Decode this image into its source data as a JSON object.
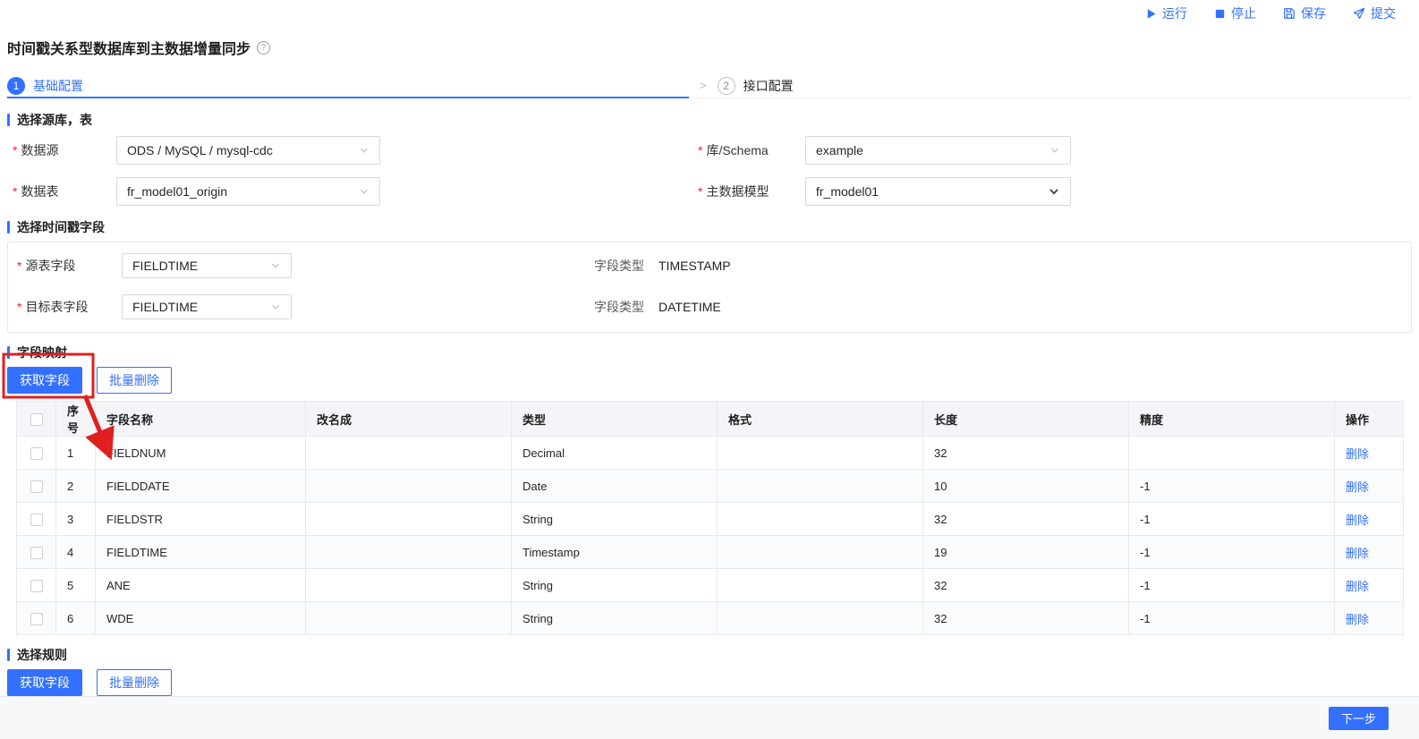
{
  "ui": {
    "required_mark": "*",
    "step_separator": ">",
    "help_mark": "?"
  },
  "colors": {
    "primary": "#3370ff",
    "annotation": "#e01f1f"
  },
  "toolbar": {
    "run_label": "运行",
    "stop_label": "停止",
    "save_label": "保存",
    "submit_label": "提交"
  },
  "page": {
    "title": "时间戳关系型数据库到主数据增量同步"
  },
  "steps": [
    {
      "num": "1",
      "label": "基础配置"
    },
    {
      "num": "2",
      "label": "接口配置"
    }
  ],
  "source_section": {
    "title": "选择源库，表",
    "datasource": {
      "label": "数据源",
      "value": "ODS / MySQL / mysql-cdc"
    },
    "schema": {
      "label": "库/Schema",
      "value": "example"
    },
    "table": {
      "label": "数据表",
      "value": "fr_model01_origin"
    },
    "model": {
      "label": "主数据模型",
      "value": "fr_model01"
    }
  },
  "timestamp_section": {
    "title": "选择时间戳字段",
    "source_field": {
      "label": "源表字段",
      "value": "FIELDTIME",
      "type_label": "字段类型",
      "type_value": "TIMESTAMP"
    },
    "target_field": {
      "label": "目标表字段",
      "value": "FIELDTIME",
      "type_label": "字段类型",
      "type_value": "DATETIME"
    }
  },
  "mapping_section": {
    "title": "字段映射",
    "get_fields_label": "获取字段",
    "batch_delete_label": "批量删除",
    "table": {
      "headers": [
        "序号",
        "字段名称",
        "改名成",
        "类型",
        "格式",
        "长度",
        "精度",
        "操作"
      ],
      "rows": [
        {
          "no": "1",
          "name": "FIELDNUM",
          "rename": "",
          "type": "Decimal",
          "format": "",
          "length": "32",
          "precision": "",
          "action": "删除"
        },
        {
          "no": "2",
          "name": "FIELDDATE",
          "rename": "",
          "type": "Date",
          "format": "",
          "length": "10",
          "precision": "-1",
          "action": "删除"
        },
        {
          "no": "3",
          "name": "FIELDSTR",
          "rename": "",
          "type": "String",
          "format": "",
          "length": "32",
          "precision": "-1",
          "action": "删除"
        },
        {
          "no": "4",
          "name": "FIELDTIME",
          "rename": "",
          "type": "Timestamp",
          "format": "",
          "length": "19",
          "precision": "-1",
          "action": "删除"
        },
        {
          "no": "5",
          "name": "ANE",
          "rename": "",
          "type": "String",
          "format": "",
          "length": "32",
          "precision": "-1",
          "action": "删除"
        },
        {
          "no": "6",
          "name": "WDE",
          "rename": "",
          "type": "String",
          "format": "",
          "length": "32",
          "precision": "-1",
          "action": "删除"
        }
      ]
    }
  },
  "rules_section": {
    "title": "选择规则",
    "get_fields_label": "获取字段",
    "batch_delete_label": "批量删除"
  },
  "footer": {
    "next_label": "下一步"
  }
}
